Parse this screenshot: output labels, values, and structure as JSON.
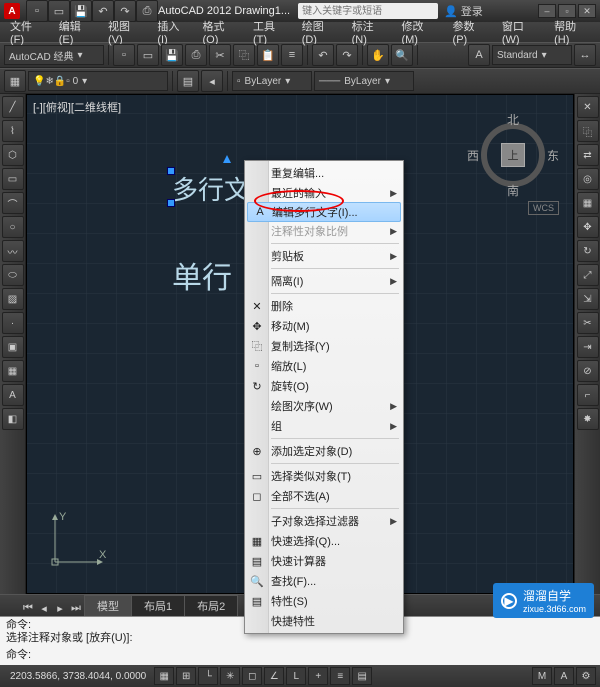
{
  "title": "AutoCAD 2012  Drawing1...",
  "search_placeholder": "键入关键字或短语",
  "user_label": "登录",
  "menu": [
    "文件(F)",
    "编辑(E)",
    "视图(V)",
    "插入(I)",
    "格式(O)",
    "工具(T)",
    "绘图(D)",
    "标注(N)",
    "修改(M)",
    "参数(P)",
    "窗口(W)",
    "帮助(H)"
  ],
  "workspace": "AutoCAD 经典",
  "style_box": "Standard",
  "layer_box": "ByLayer",
  "linetype_box": "ByLayer",
  "view_label": "[-][俯视][二维线框]",
  "canvas_text1": "多行文字",
  "canvas_text2": "单行",
  "compass": {
    "n": "北",
    "s": "南",
    "e": "东",
    "w": "西",
    "top": "上",
    "wcs": "WCS"
  },
  "ucs": {
    "x": "X",
    "y": "Y"
  },
  "tabs": [
    "模型",
    "布局1",
    "布局2"
  ],
  "cmd_history": [
    "命令:",
    "选择注释对象或 [放弃(U)]:",
    "命令:"
  ],
  "cmd_prompt": "命令:",
  "coords": "2203.5866, 3738.4044, 0.0000",
  "context_menu": {
    "items": [
      {
        "label": "重复编辑...",
        "sub": false
      },
      {
        "label": "最近的输入",
        "sub": true
      },
      {
        "label": "编辑多行文字(I)...",
        "sub": false,
        "hl": true,
        "icon": "A"
      },
      {
        "label": "注释性对象比例",
        "sub": true,
        "gray": true
      },
      {
        "sep": true
      },
      {
        "label": "剪贴板",
        "sub": true
      },
      {
        "sep": true
      },
      {
        "label": "隔离(I)",
        "sub": true
      },
      {
        "sep": true
      },
      {
        "label": "删除",
        "icon": "✕"
      },
      {
        "label": "移动(M)",
        "icon": "✥"
      },
      {
        "label": "复制选择(Y)",
        "icon": "⿻"
      },
      {
        "label": "缩放(L)",
        "icon": "▫"
      },
      {
        "label": "旋转(O)",
        "icon": "↻"
      },
      {
        "label": "绘图次序(W)",
        "sub": true
      },
      {
        "label": "组",
        "sub": true
      },
      {
        "sep": true
      },
      {
        "label": "添加选定对象(D)",
        "icon": "⊕"
      },
      {
        "sep": true
      },
      {
        "label": "选择类似对象(T)",
        "icon": "▭"
      },
      {
        "label": "全部不选(A)",
        "icon": "◻"
      },
      {
        "sep": true
      },
      {
        "label": "子对象选择过滤器",
        "sub": true
      },
      {
        "label": "快速选择(Q)...",
        "icon": "▦"
      },
      {
        "label": "快速计算器",
        "icon": "▤"
      },
      {
        "label": "查找(F)...",
        "icon": "🔍"
      },
      {
        "label": "特性(S)",
        "icon": "▤"
      },
      {
        "label": "快捷特性"
      }
    ]
  },
  "watermark": {
    "brand": "溜溜自学",
    "url": "zixue.3d66.com"
  }
}
